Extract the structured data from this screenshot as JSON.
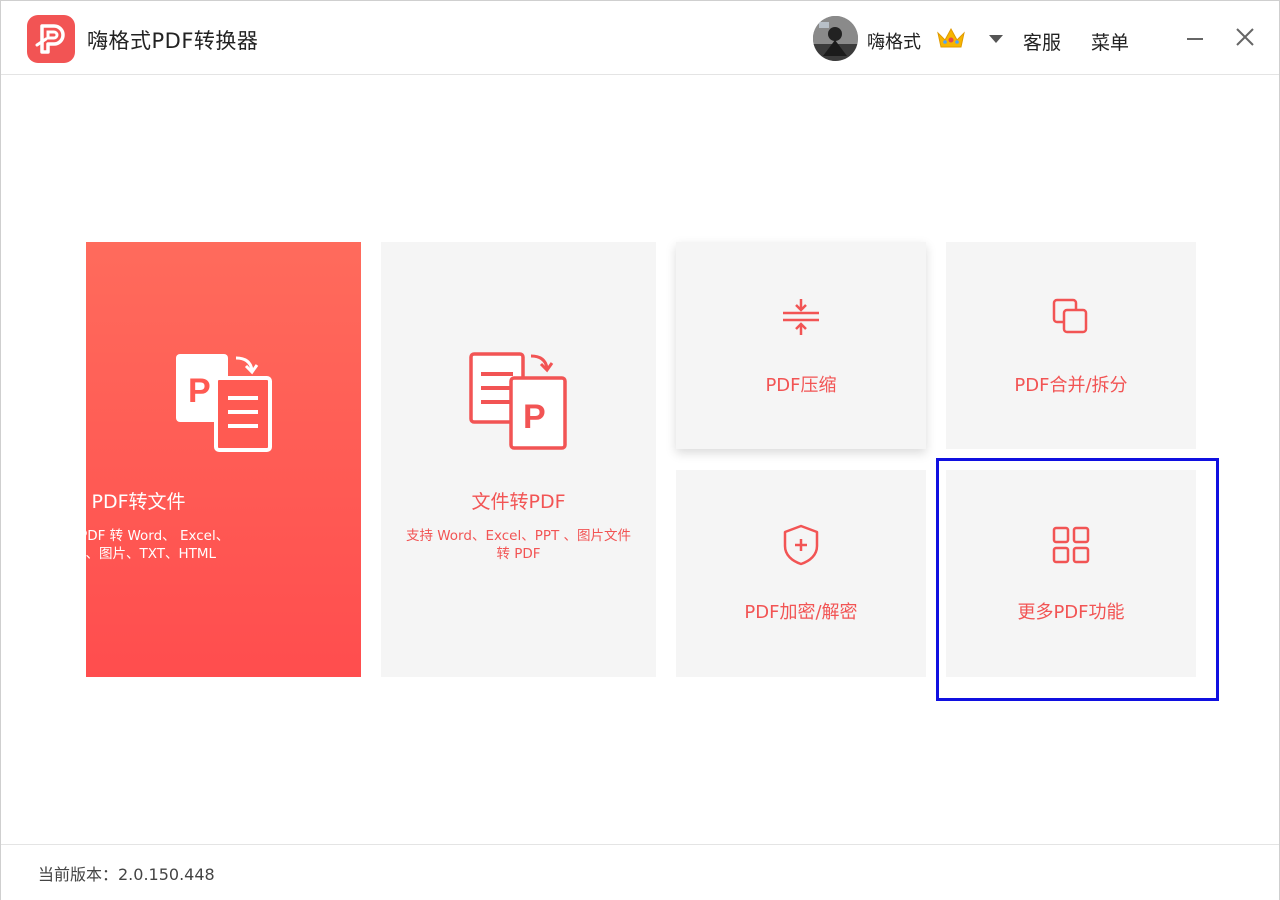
{
  "app": {
    "title": "嗨格式PDF转换器"
  },
  "header": {
    "username": "嗨格式",
    "service_label": "客服",
    "menu_label": "菜单"
  },
  "cards": {
    "pdf_to_file": {
      "title": "PDF转文件",
      "desc": "支持 PDF 转 Word、 Excel、PPT、图片、TXT、HTML"
    },
    "file_to_pdf": {
      "title": "文件转PDF",
      "desc": "支持 Word、Excel、PPT 、图片文件转 PDF"
    },
    "compress": {
      "title": "PDF压缩"
    },
    "merge_split": {
      "title": "PDF合并/拆分"
    },
    "encrypt": {
      "title": "PDF加密/解密"
    },
    "more": {
      "title": "更多PDF功能"
    }
  },
  "footer": {
    "version_label": "当前版本：2.0.150.448"
  },
  "colors": {
    "accent": "#f25454",
    "highlight": "#1010e0"
  }
}
